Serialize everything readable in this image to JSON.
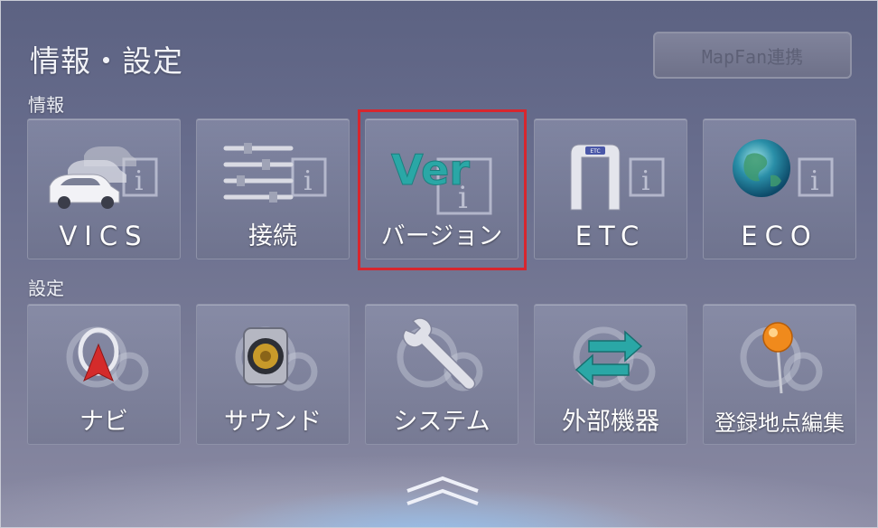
{
  "header": {
    "title": "情報・設定",
    "mapfan_button": "MapFan連携"
  },
  "sections": {
    "info_label": "情報",
    "settings_label": "設定"
  },
  "info_tiles": [
    {
      "label": "VICS",
      "icon": "vics-cars-icon"
    },
    {
      "label": "接続",
      "icon": "connection-sliders-icon"
    },
    {
      "label": "バージョン",
      "icon": "version-ver-icon",
      "badge": "Ver"
    },
    {
      "label": "ETC",
      "icon": "etc-gate-icon",
      "badge": "ETC"
    },
    {
      "label": "ECO",
      "icon": "eco-globe-icon"
    }
  ],
  "settings_tiles": [
    {
      "label": "ナビ",
      "icon": "navi-compass-icon"
    },
    {
      "label": "サウンド",
      "icon": "speaker-icon"
    },
    {
      "label": "システム",
      "icon": "wrench-icon"
    },
    {
      "label": "外部機器",
      "icon": "external-device-arrows-icon"
    },
    {
      "label": "登録地点編集",
      "icon": "map-pin-icon"
    }
  ],
  "colors": {
    "highlight": "#d7262e",
    "accent_teal": "#2aa7a6"
  },
  "selected_tile": "バージョン"
}
